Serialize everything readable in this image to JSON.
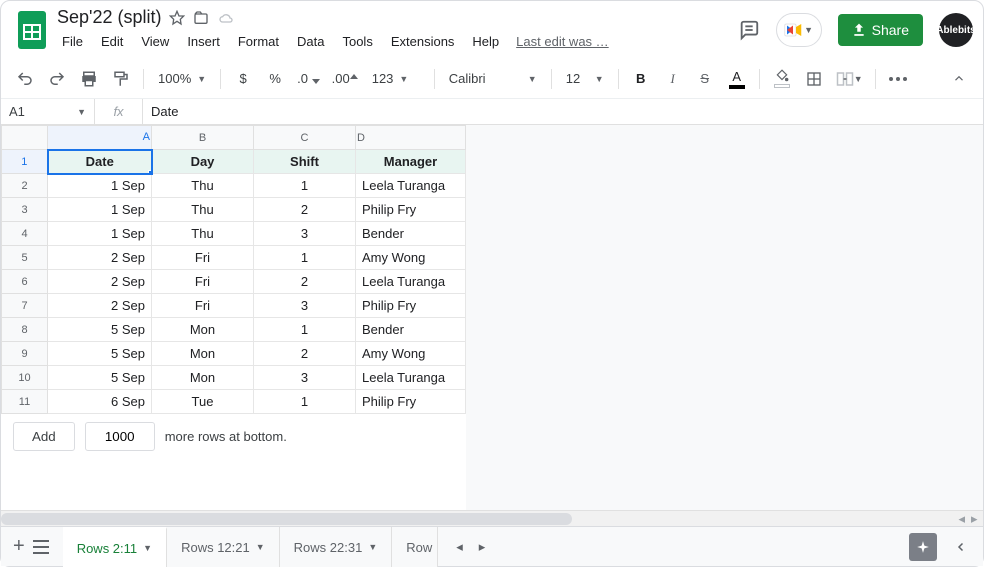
{
  "header": {
    "doc_title": "Sep'22 (split)",
    "menus": [
      "File",
      "Edit",
      "View",
      "Insert",
      "Format",
      "Data",
      "Tools",
      "Extensions",
      "Help"
    ],
    "last_edit": "Last edit was …",
    "share_label": "Share",
    "avatar_label": "Ablebits"
  },
  "toolbar": {
    "zoom": "100%",
    "number_format": "123",
    "font": "Calibri",
    "font_size": "12"
  },
  "namebox": {
    "cell": "A1"
  },
  "formula": {
    "fx": "fx",
    "value": "Date"
  },
  "columns": [
    "A",
    "B",
    "C",
    "D"
  ],
  "sel": {
    "col": "A",
    "row": 1
  },
  "row_nums": [
    1,
    2,
    3,
    4,
    5,
    6,
    7,
    8,
    9,
    10,
    11
  ],
  "rows": [
    {
      "date": "Date",
      "day": "Day",
      "shift": "Shift",
      "manager": "Manager",
      "hdr": true
    },
    {
      "date": "1 Sep",
      "day": "Thu",
      "shift": "1",
      "manager": "Leela Turanga"
    },
    {
      "date": "1 Sep",
      "day": "Thu",
      "shift": "2",
      "manager": "Philip Fry"
    },
    {
      "date": "1 Sep",
      "day": "Thu",
      "shift": "3",
      "manager": "Bender"
    },
    {
      "date": "2 Sep",
      "day": "Fri",
      "shift": "1",
      "manager": "Amy Wong"
    },
    {
      "date": "2 Sep",
      "day": "Fri",
      "shift": "2",
      "manager": "Leela Turanga"
    },
    {
      "date": "2 Sep",
      "day": "Fri",
      "shift": "3",
      "manager": "Philip Fry"
    },
    {
      "date": "5 Sep",
      "day": "Mon",
      "shift": "1",
      "manager": "Bender"
    },
    {
      "date": "5 Sep",
      "day": "Mon",
      "shift": "2",
      "manager": "Amy Wong"
    },
    {
      "date": "5 Sep",
      "day": "Mon",
      "shift": "3",
      "manager": "Leela Turanga"
    },
    {
      "date": "6 Sep",
      "day": "Tue",
      "shift": "1",
      "manager": "Philip Fry"
    }
  ],
  "add_rows": {
    "button": "Add",
    "count": "1000",
    "suffix": "more rows at bottom."
  },
  "tabs": {
    "items": [
      {
        "label": "Rows 2:11",
        "active": true
      },
      {
        "label": "Rows 12:21",
        "active": false
      },
      {
        "label": "Rows 22:31",
        "active": false
      },
      {
        "label": "Row",
        "active": false,
        "cut": true
      }
    ]
  },
  "colors": {
    "accent": "#1a73e8",
    "share": "#1e8e3e",
    "text_color_underline": "#000000",
    "header_row": "#e8f5f1"
  },
  "icons": {
    "currency": "$",
    "percent": "%",
    "bold": "B",
    "italic": "I",
    "strikethrough": "S",
    "text_color": "A"
  }
}
